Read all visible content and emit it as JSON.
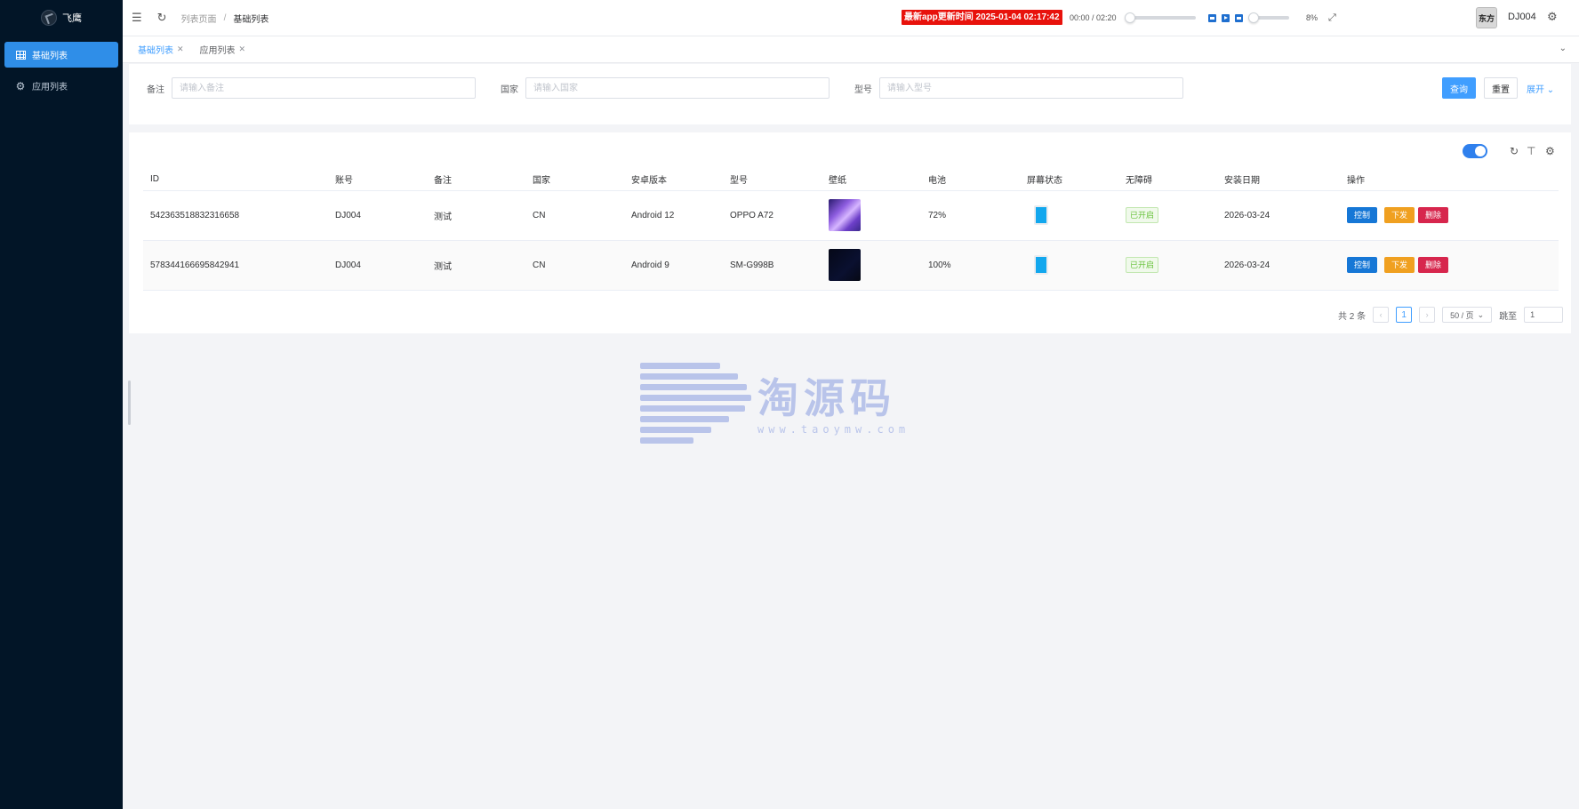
{
  "app": {
    "name": "飞鹰"
  },
  "sidebar": {
    "items": [
      {
        "label": "基础列表",
        "icon": "table-grid-icon",
        "active": true
      },
      {
        "label": "应用列表",
        "icon": "gear-icon",
        "active": false
      }
    ]
  },
  "header": {
    "breadcrumb": [
      "列表页面",
      "基础列表"
    ],
    "breadcrumb_sep": "/",
    "notice": "最新app更新时间 2025-01-04 02:17:42",
    "player": {
      "time": "00:00 / 02:20",
      "progress": 0,
      "volume_label": "8%",
      "volume": 0.08
    },
    "username": "DJ004",
    "avatar_text": "东方"
  },
  "tabs": [
    {
      "label": "基础列表",
      "active": true
    },
    {
      "label": "应用列表",
      "active": false
    }
  ],
  "search": {
    "fields": [
      {
        "label": "备注",
        "placeholder": "请输入备注"
      },
      {
        "label": "国家",
        "placeholder": "请输入国家"
      },
      {
        "label": "型号",
        "placeholder": "请输入型号"
      }
    ],
    "query_label": "查询",
    "reset_label": "重置",
    "expand_label": "展开"
  },
  "table": {
    "columns": [
      "ID",
      "账号",
      "备注",
      "国家",
      "安卓版本",
      "型号",
      "壁纸",
      "电池",
      "屏幕状态",
      "无障碍",
      "安装日期",
      "操作"
    ],
    "rows": [
      {
        "id": "542363518832316658",
        "account": "DJ004",
        "remark": "测试",
        "country": "CN",
        "android": "Android 12",
        "model": "OPPO A72",
        "wallpaper": "purple",
        "battery": "72%",
        "accessibility": "已开启",
        "install_date": "2026-03-24"
      },
      {
        "id": "578344166695842941",
        "account": "DJ004",
        "remark": "测试",
        "country": "CN",
        "android": "Android 9",
        "model": "SM-G998B",
        "wallpaper": "dark",
        "battery": "100%",
        "accessibility": "已开启",
        "install_date": "2026-03-24"
      }
    ],
    "actions": {
      "control": "控制",
      "send": "下发",
      "delete": "删除"
    }
  },
  "pagination": {
    "total": "共 2 条",
    "current_page": "1",
    "page_size": "50 / 页",
    "jump_label": "跳至",
    "jump_value": "1"
  },
  "watermark": {
    "text": "淘源码",
    "url": "www.taoymw.com"
  },
  "colors": {
    "sidebar_bg": "#021527",
    "primary": "#409eff",
    "notice_bg": "#e8120c",
    "warning": "#f0a020",
    "danger": "#d7264d"
  }
}
